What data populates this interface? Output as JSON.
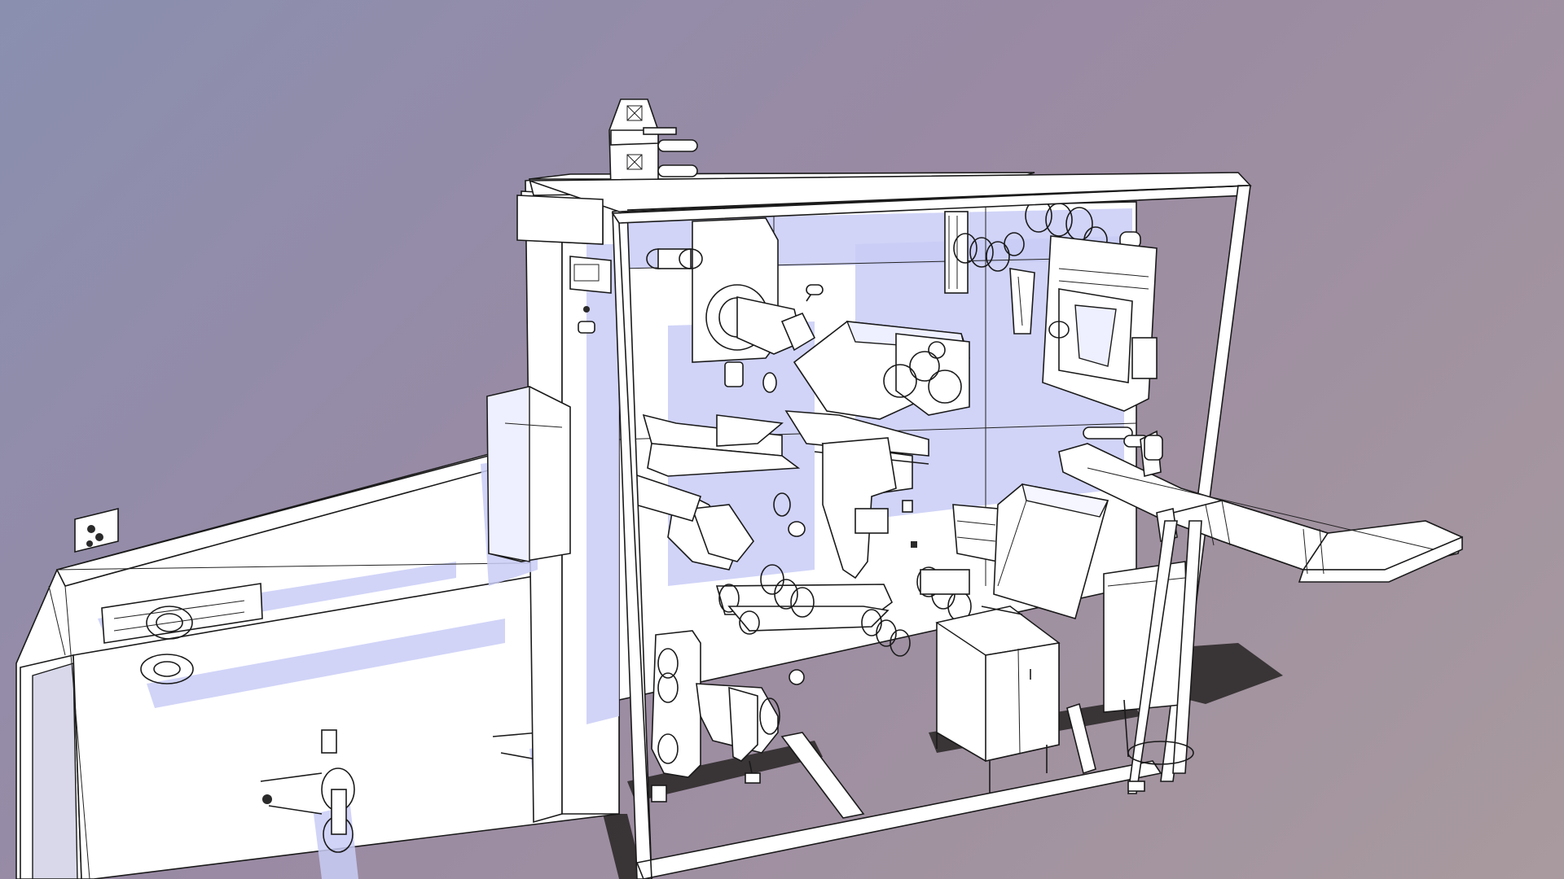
{
  "viewport": {
    "background_top": "#8a8fb0",
    "background_bottom": "#a89a9e",
    "model_fill": "#ffffff",
    "model_shadow": "#c9ccf6",
    "outline": "#1a1a1a"
  },
  "scene": {
    "icons": [
      "machine-frame-icon",
      "roller-spindle-icon",
      "conveyor-chute-icon",
      "control-cabinet-icon"
    ]
  }
}
